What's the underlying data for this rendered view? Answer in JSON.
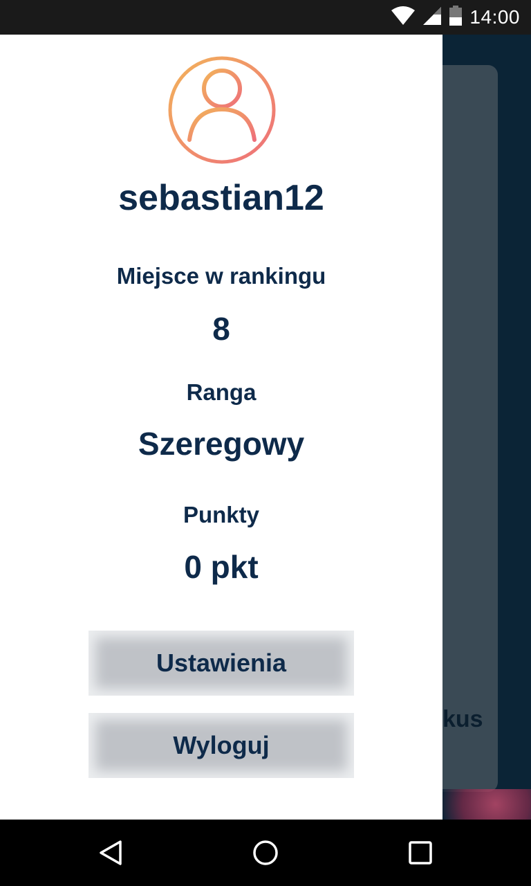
{
  "status_bar": {
    "time": "14:00",
    "icons": [
      "wifi-icon",
      "signal-icon",
      "battery-icon"
    ]
  },
  "background": {
    "partial_text": "kus"
  },
  "drawer": {
    "username": "sebastian12",
    "ranking": {
      "label": "Miejsce w rankingu",
      "value": "8"
    },
    "grade": {
      "label": "Ranga",
      "value": "Szeregowy"
    },
    "points": {
      "label": "Punkty",
      "value": "0 pkt"
    },
    "buttons": {
      "settings": "Ustawienia",
      "logout": "Wyloguj"
    }
  },
  "nav_bar": {
    "icons": [
      "back-icon",
      "home-icon",
      "recents-icon"
    ]
  },
  "colors": {
    "text_primary": "#0e2a4a",
    "avatar_gradient_start": "#f2b35a",
    "avatar_gradient_end": "#ee6f7a",
    "status_bar": "#1a1a1a",
    "nav_bar": "#000000",
    "button_bg": "#bfc2c7"
  }
}
